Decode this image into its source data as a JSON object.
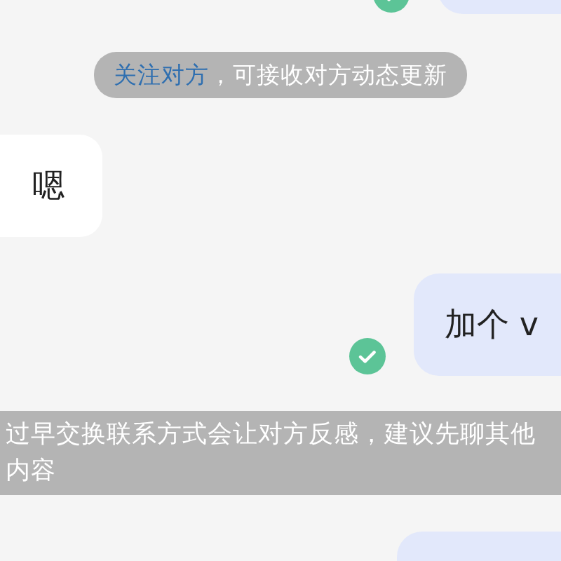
{
  "items": [
    {
      "kind": "sent",
      "delivered": true
    },
    {
      "kind": "notice",
      "link": "关注对方",
      "text": "，可接收对方动态更新"
    },
    {
      "kind": "received",
      "text": "嗯"
    },
    {
      "kind": "sent",
      "text": "加个 v",
      "delivered": true
    },
    {
      "kind": "warning",
      "text": "过早交换联系方式会让对方反感，建议先聊其他内容"
    },
    {
      "kind": "sent"
    }
  ]
}
